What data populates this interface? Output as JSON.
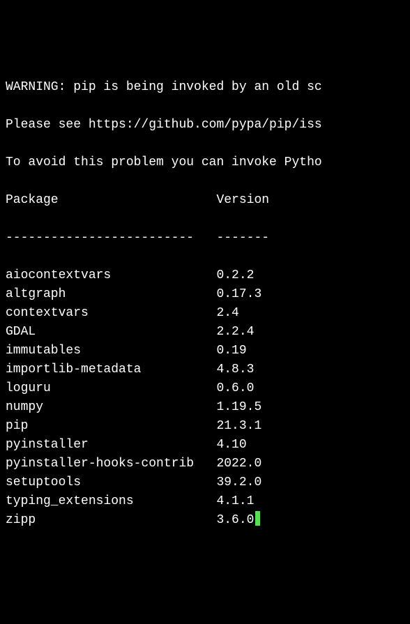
{
  "warnings": {
    "line1": "WARNING: pip is being invoked by an old sc",
    "line2": "Please see https://github.com/pypa/pip/iss",
    "line3": "To avoid this problem you can invoke Pytho"
  },
  "headers": {
    "package": "Package",
    "version": "Version"
  },
  "separator": {
    "package": "-------------------------",
    "version": "-------"
  },
  "packages": [
    {
      "name": "aiocontextvars",
      "version": "0.2.2"
    },
    {
      "name": "altgraph",
      "version": "0.17.3"
    },
    {
      "name": "contextvars",
      "version": "2.4"
    },
    {
      "name": "GDAL",
      "version": "2.2.4"
    },
    {
      "name": "immutables",
      "version": "0.19"
    },
    {
      "name": "importlib-metadata",
      "version": "4.8.3"
    },
    {
      "name": "loguru",
      "version": "0.6.0"
    },
    {
      "name": "numpy",
      "version": "1.19.5"
    },
    {
      "name": "pip",
      "version": "21.3.1"
    },
    {
      "name": "pyinstaller",
      "version": "4.10"
    },
    {
      "name": "pyinstaller-hooks-contrib",
      "version": "2022.0"
    },
    {
      "name": "setuptools",
      "version": "39.2.0"
    },
    {
      "name": "typing_extensions",
      "version": "4.1.1"
    },
    {
      "name": "zipp",
      "version": "3.6.0"
    }
  ]
}
